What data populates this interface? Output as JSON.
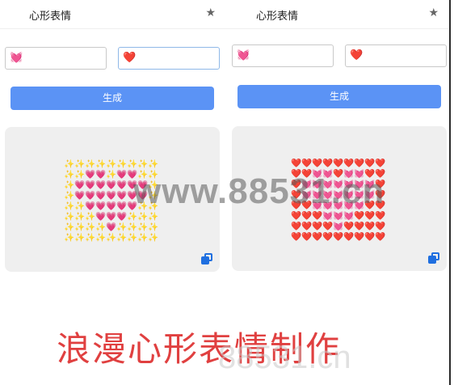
{
  "app": {
    "title": "心形表情",
    "star_icon": "★"
  },
  "left": {
    "input1": "💓",
    "input2": "❤️",
    "button_label": "生成",
    "grid": [
      [
        "✨",
        "✨",
        "✨",
        "✨",
        "✨",
        "✨",
        "✨",
        "✨",
        "✨"
      ],
      [
        "✨",
        "✨",
        "💗",
        "💗",
        "✨",
        "💗",
        "💗",
        "✨",
        "✨"
      ],
      [
        "✨",
        "💗",
        "💗",
        "💗",
        "💗",
        "💗",
        "💗",
        "💗",
        "✨"
      ],
      [
        "✨",
        "💗",
        "💗",
        "💗",
        "💗",
        "💗",
        "💗",
        "💗",
        "✨"
      ],
      [
        "✨",
        "✨",
        "💗",
        "💗",
        "💗",
        "💗",
        "💗",
        "✨",
        "✨"
      ],
      [
        "✨",
        "✨",
        "✨",
        "💗",
        "💗",
        "💗",
        "✨",
        "✨",
        "✨"
      ],
      [
        "✨",
        "✨",
        "✨",
        "✨",
        "💗",
        "✨",
        "✨",
        "✨",
        "✨"
      ],
      [
        "✨",
        "✨",
        "✨",
        "✨",
        "✨",
        "✨",
        "✨",
        "✨",
        "✨"
      ]
    ]
  },
  "right": {
    "input1": "💓",
    "input2": "❤️",
    "button_label": "生成",
    "grid": [
      [
        "❤️",
        "❤️",
        "❤️",
        "❤️",
        "❤️",
        "❤️",
        "❤️",
        "❤️",
        "❤️"
      ],
      [
        "❤️",
        "❤️",
        "💓",
        "💓",
        "❤️",
        "💓",
        "💓",
        "❤️",
        "❤️"
      ],
      [
        "❤️",
        "💓",
        "💓",
        "💓",
        "💓",
        "💓",
        "💓",
        "💓",
        "❤️"
      ],
      [
        "❤️",
        "💓",
        "💓",
        "💓",
        "💓",
        "💓",
        "💓",
        "💓",
        "❤️"
      ],
      [
        "❤️",
        "❤️",
        "💓",
        "💓",
        "💓",
        "💓",
        "💓",
        "❤️",
        "❤️"
      ],
      [
        "❤️",
        "❤️",
        "❤️",
        "💓",
        "💓",
        "💓",
        "❤️",
        "❤️",
        "❤️"
      ],
      [
        "❤️",
        "❤️",
        "❤️",
        "❤️",
        "💓",
        "❤️",
        "❤️",
        "❤️",
        "❤️"
      ],
      [
        "❤️",
        "❤️",
        "❤️",
        "❤️",
        "❤️",
        "❤️",
        "❤️",
        "❤️",
        "❤️"
      ]
    ]
  },
  "icons": {
    "copy": "copy-icon"
  },
  "watermark": "www.88531.cn",
  "caption": "浪漫心形表情制作",
  "caption_watermark": "88531.cn",
  "colors": {
    "button": "#5b93f5",
    "caption": "#e04040",
    "copy_icon": "#1f6fe0"
  }
}
